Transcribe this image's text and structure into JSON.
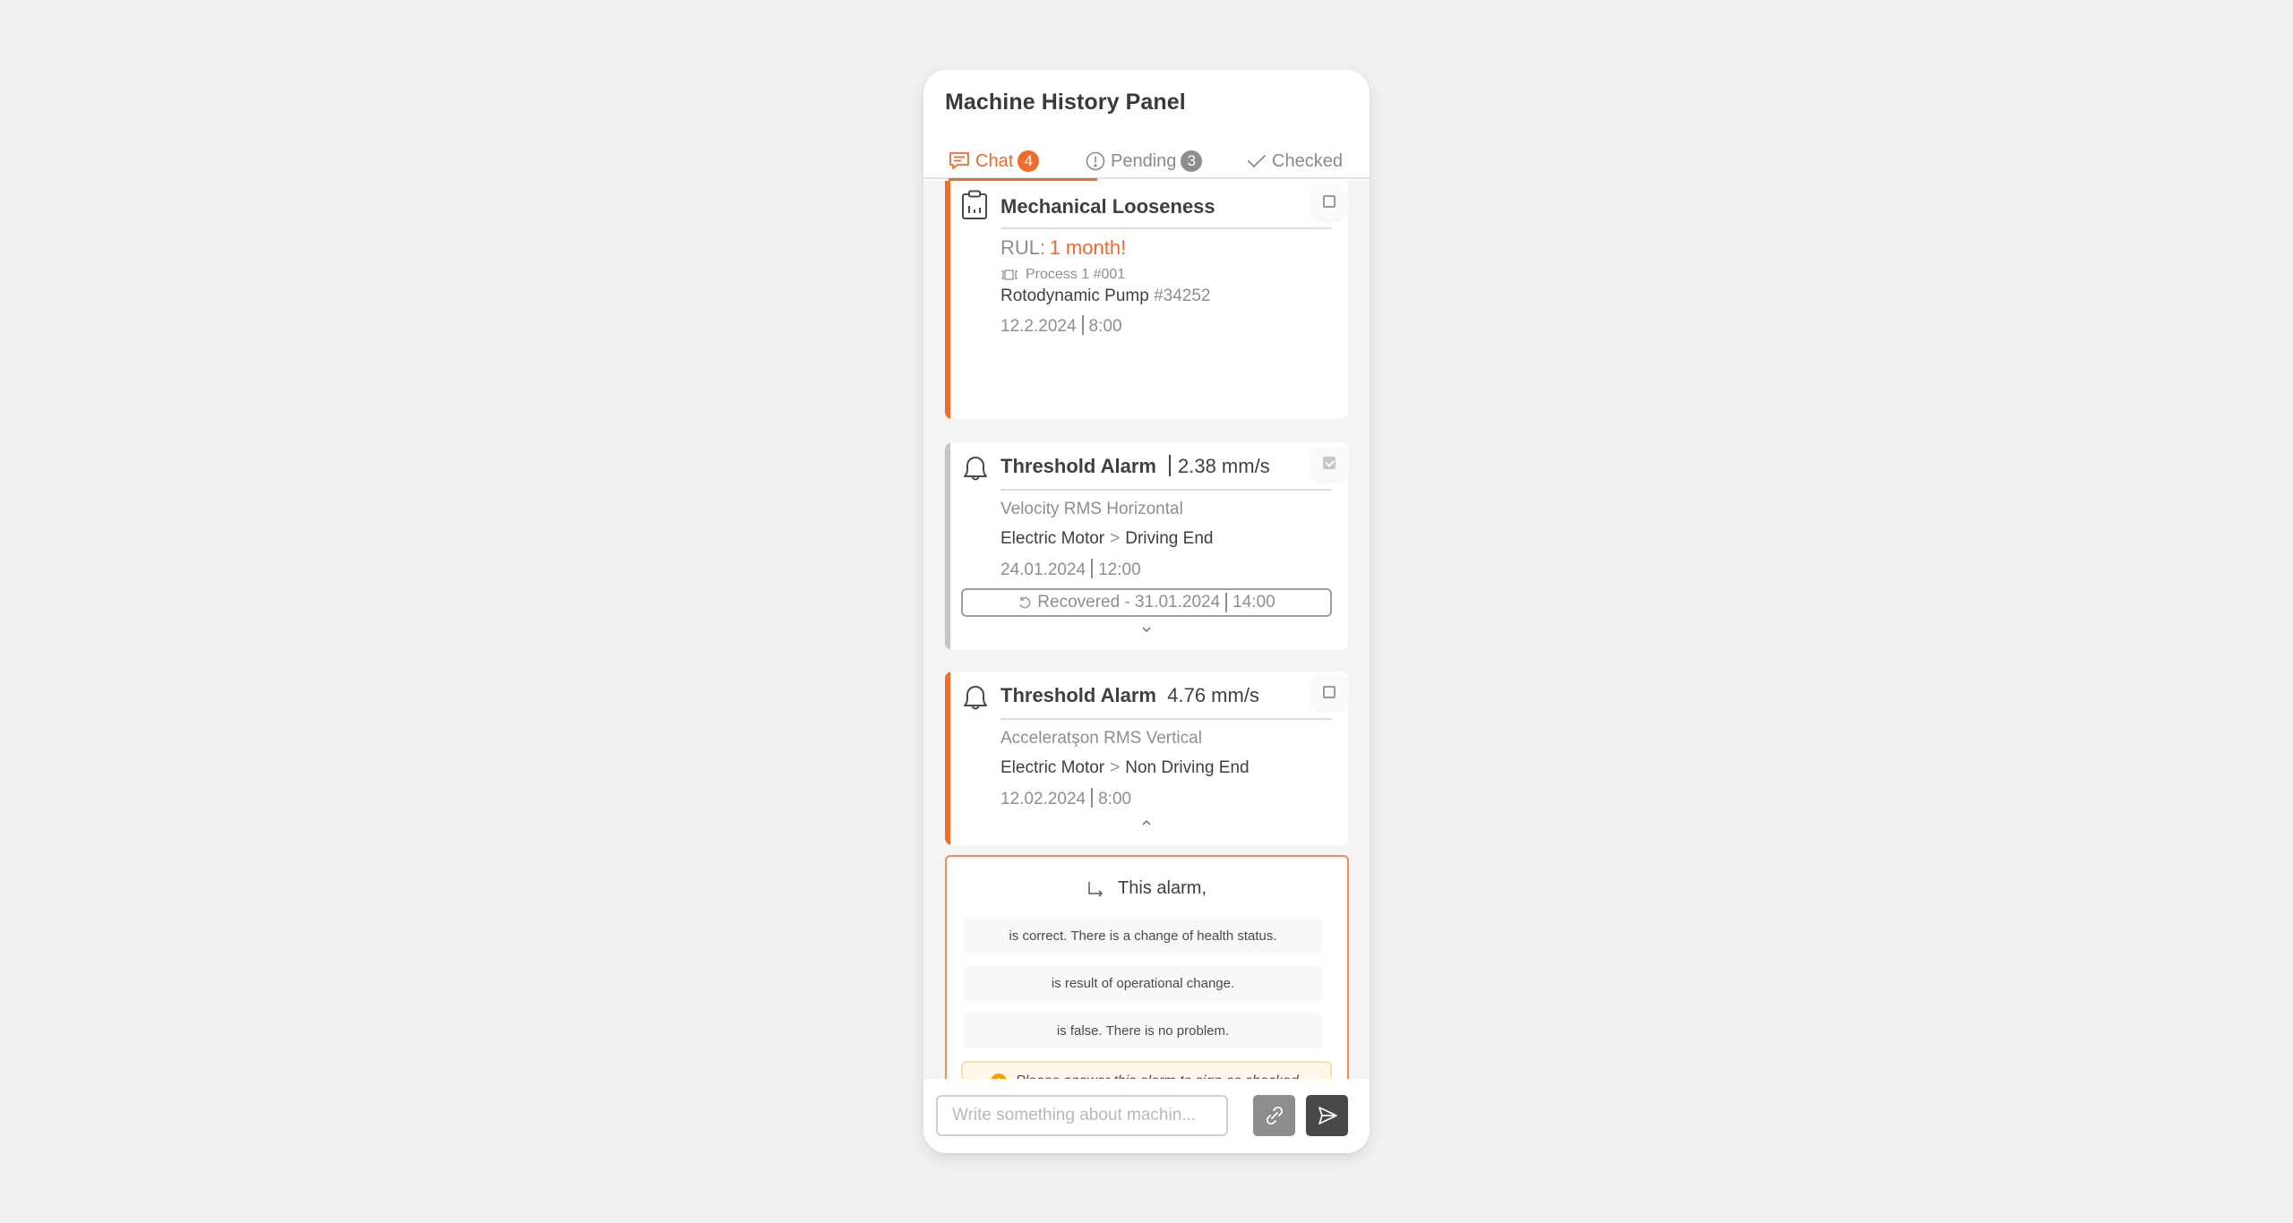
{
  "panel": {
    "title": "Machine History Panel"
  },
  "tabs": [
    {
      "label": "Chat",
      "badge": "4",
      "icon": "chat-icon",
      "active": true
    },
    {
      "label": "Pending",
      "badge": "3",
      "icon": "exclamation-circle-icon",
      "active": false
    },
    {
      "label": "Checked",
      "badge": null,
      "icon": "check-icon",
      "active": false
    }
  ],
  "cards": [
    {
      "type": "diagnosis",
      "icon": "clipboard-chart-icon",
      "accent": "#f06a2a",
      "title": "Mechanical Looseness",
      "checked": false,
      "rul_label": "RUL:",
      "rul_value": "1 month!",
      "process_icon": "process-icon",
      "process": "Process 1",
      "process_id": "#001",
      "machine": "Rotodynamic Pump",
      "machine_id": "#34252",
      "date": "12.2.2024",
      "time": "8:00"
    },
    {
      "type": "alarm",
      "icon": "bell-icon",
      "accent": "#c4c4c4",
      "title": "Threshold Alarm",
      "value": "2.38 mm/s",
      "checked": true,
      "metric": "Velocity RMS Horizontal",
      "component": "Electric Motor",
      "sub_component": "Driving End",
      "crumb_separator": ">",
      "date": "24.01.2024",
      "time": "12:00",
      "recovered_label": "Recovered - 31.01.2024",
      "recovered_time": "14:00",
      "expand_icon": "chevron-down-icon"
    },
    {
      "type": "alarm",
      "icon": "bell-icon",
      "accent": "#f06a2a",
      "title": "Threshold Alarm",
      "value": "4.76 mm/s",
      "checked": false,
      "metric": "Acceleratşon RMS Vertical",
      "component": "Electric Motor",
      "sub_component": "Non Driving End",
      "crumb_separator": ">",
      "date": "12.02.2024",
      "time": "8:00",
      "expand_icon": "chevron-up-icon"
    }
  ],
  "answer": {
    "heading": "This alarm,",
    "options": [
      "is correct. There is a change of health status.",
      "is result of operational change.",
      "is false. There is no problem."
    ],
    "warning_icon": "!",
    "warning": "Please answer this alarm to sign as checked."
  },
  "composer": {
    "placeholder": "Write something about machin...",
    "value": "",
    "attach_icon": "paperclip-icon",
    "send_icon": "send-icon"
  },
  "colors": {
    "accent": "#f06a2a",
    "muted": "#8e8e8e",
    "warning": "#f5a000"
  }
}
